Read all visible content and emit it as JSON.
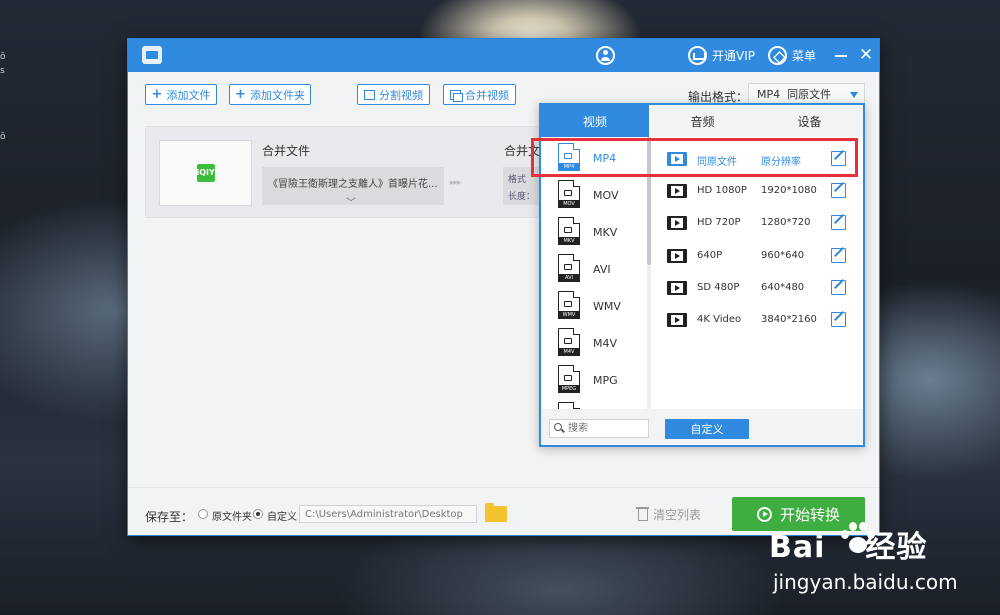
{
  "window": {
    "title": ""
  },
  "titlebar": {
    "vip": "开通VIP",
    "menu": "菜单",
    "close": "✕"
  },
  "toolbar": {
    "add_file": "添加文件",
    "add_folder": "添加文件夹",
    "split_video": "分割视频",
    "merge_video": "合并视频",
    "output_label": "输出格式：",
    "output_value": "MP4  同原文件"
  },
  "file_card": {
    "thumb_logo": "iQIY",
    "merge_title": "合并文件",
    "clip_name": "《冒險王衛斯理之支離人》首曝片花...",
    "clip_more": "﹀",
    "out_title": "合并文",
    "out_format_label": "格式",
    "out_length_label": "长度："
  },
  "bottombar": {
    "save_label": "保存至：",
    "opt_original": "原文件夹",
    "opt_custom": "自定义",
    "path_value": "C:\\Users\\Administrator\\Desktop",
    "clear_list": "清空列表",
    "start": "开始转换"
  },
  "format_panel": {
    "tabs": [
      "视频",
      "音频",
      "设备"
    ],
    "formats": [
      {
        "name": "MP4",
        "band": "MP4"
      },
      {
        "name": "MOV",
        "band": "MOV"
      },
      {
        "name": "MKV",
        "band": "MKV"
      },
      {
        "name": "AVI",
        "band": "AVI"
      },
      {
        "name": "WMV",
        "band": "WMV"
      },
      {
        "name": "M4V",
        "band": "M4V"
      },
      {
        "name": "MPG",
        "band": "MPEG"
      }
    ],
    "resolutions": [
      {
        "name": "同原文件",
        "size": "原分辨率"
      },
      {
        "name": "HD 1080P",
        "size": "1920*1080"
      },
      {
        "name": "HD 720P",
        "size": "1280*720"
      },
      {
        "name": "640P",
        "size": "960*640"
      },
      {
        "name": "SD 480P",
        "size": "640*480"
      },
      {
        "name": "4K Video",
        "size": "3840*2160"
      }
    ],
    "search_placeholder": "搜索",
    "custom_button": "自定义"
  },
  "watermark": {
    "brand": "Bai",
    "brand2": "经验",
    "site": "jingyan.baidu.com"
  },
  "colors": {
    "accent": "#2f8ae0",
    "start": "#3dae3f",
    "highlight": "#e6313a"
  }
}
